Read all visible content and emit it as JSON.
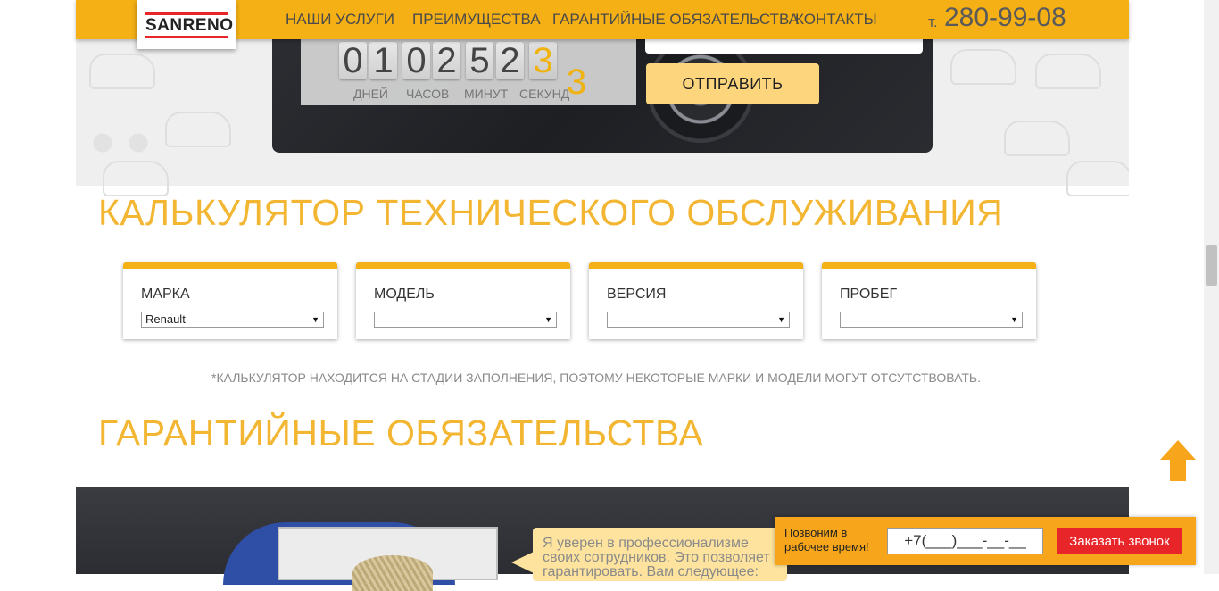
{
  "header": {
    "logo": "SANRENO",
    "nav": [
      "НАШИ УСЛУГИ",
      "ПРЕИМУЩЕСТВА",
      "ГАРАНТИЙНЫЕ ОБЯЗАТЕЛЬСТВА",
      "КОНТАКТЫ"
    ],
    "phone_prefix": "т.",
    "phone": "280-99-08"
  },
  "countdown": {
    "digits": [
      "0",
      "1",
      "0",
      "2",
      "5",
      "2",
      "3"
    ],
    "extra_digit": "3",
    "labels": [
      "ДНЕЙ",
      "ЧАСОВ",
      "МИНУТ",
      "СЕКУНД"
    ]
  },
  "hero": {
    "submit_label": "ОТПРАВИТЬ"
  },
  "calculator": {
    "title": "КАЛЬКУЛЯТОР ТЕХНИЧЕСКОГО ОБСЛУЖИВАНИЯ",
    "fields": [
      {
        "label": "МАРКА",
        "value": "Renault"
      },
      {
        "label": "МОДЕЛЬ",
        "value": ""
      },
      {
        "label": "ВЕРСИЯ",
        "value": ""
      },
      {
        "label": "ПРОБЕГ",
        "value": ""
      }
    ],
    "note": "*КАЛЬКУЛЯТОР НАХОДИТСЯ НА СТАДИИ ЗАПОЛНЕНИЯ, ПОЭТОМУ НЕКОТОРЫЕ МАРКИ И МОДЕЛИ МОГУТ ОТСУТСТВОВАТЬ."
  },
  "guarantee": {
    "title": "ГАРАНТИЙНЫЕ ОБЯЗАТЕЛЬСТВА",
    "quote": "Я уверен в профессионализме своих сотрудников. Это позволяет гарантировать. Вам следующее:"
  },
  "callback": {
    "text": "Позвоним в рабочее время!",
    "input_value": "+7(___)___-__-__",
    "button_label": "Заказать звонок"
  },
  "colors": {
    "accent": "#f4b014",
    "title": "#f3b632",
    "button_yellow": "#fdd57d",
    "callback_bg": "#f7a51b",
    "callback_button": "#e8262a"
  }
}
